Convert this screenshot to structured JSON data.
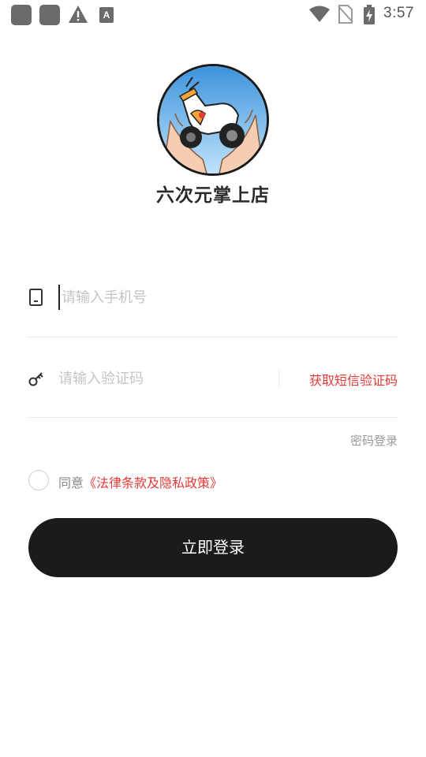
{
  "status_bar": {
    "time": "3:57",
    "a_icon_letter": "A",
    "icons": [
      "app-notification-icon",
      "app-notification-icon",
      "warning-icon",
      "a-icon",
      "wifi-icon",
      "no-sim-icon",
      "battery-charging-icon"
    ]
  },
  "brand": {
    "name": "六次元掌上店"
  },
  "form": {
    "phone_placeholder": "请输入手机号",
    "code_placeholder": "请输入验证码",
    "get_code_label": "获取短信验证码",
    "password_login_label": "密码登录"
  },
  "agreement": {
    "prefix": "同意",
    "link": "《法律条款及隐私政策》"
  },
  "login_button": {
    "label": "立即登录"
  },
  "colors": {
    "accent": "#e53935",
    "button_bg": "#1b1b1b",
    "placeholder": "#c4c4c4",
    "logo_sky": "#4a9fe0"
  }
}
